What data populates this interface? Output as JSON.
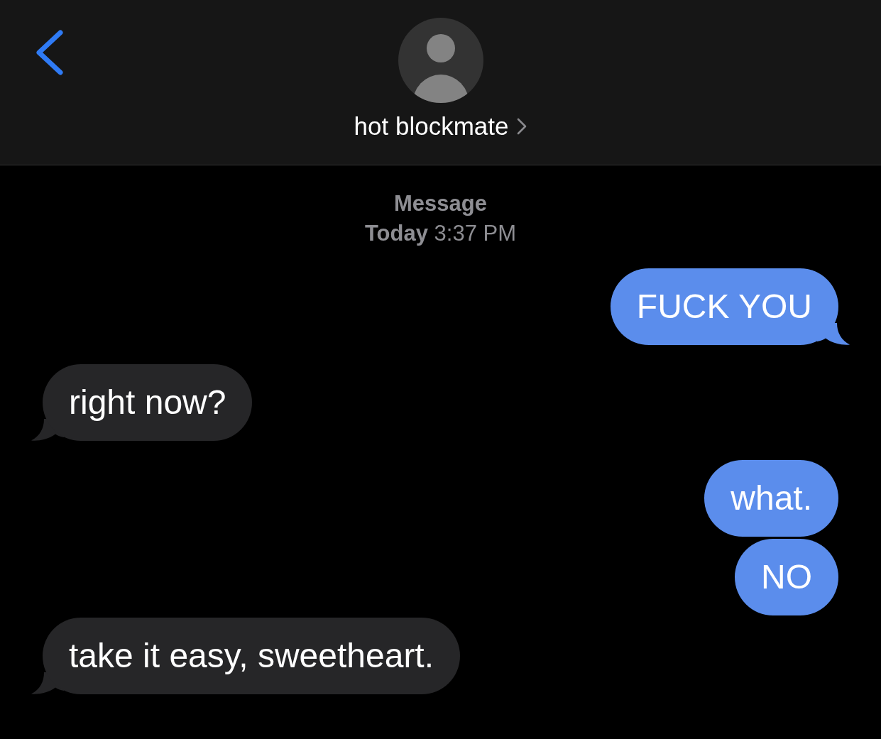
{
  "header": {
    "contact_name": "hot blockmate"
  },
  "timestamp": {
    "service": "Message",
    "time": "**Today** 3:37 PM"
  },
  "messages": [
    {
      "kind": "sent",
      "text": "FUCK YOU",
      "tail": true
    },
    {
      "kind": "received",
      "text": "right now?",
      "tail": true
    },
    {
      "kind": "sent",
      "text": "what.",
      "tail": false
    },
    {
      "kind": "sent",
      "text": "NO",
      "tail": false
    },
    {
      "kind": "received",
      "text": "take it easy, sweetheart.",
      "tail": true
    }
  ]
}
